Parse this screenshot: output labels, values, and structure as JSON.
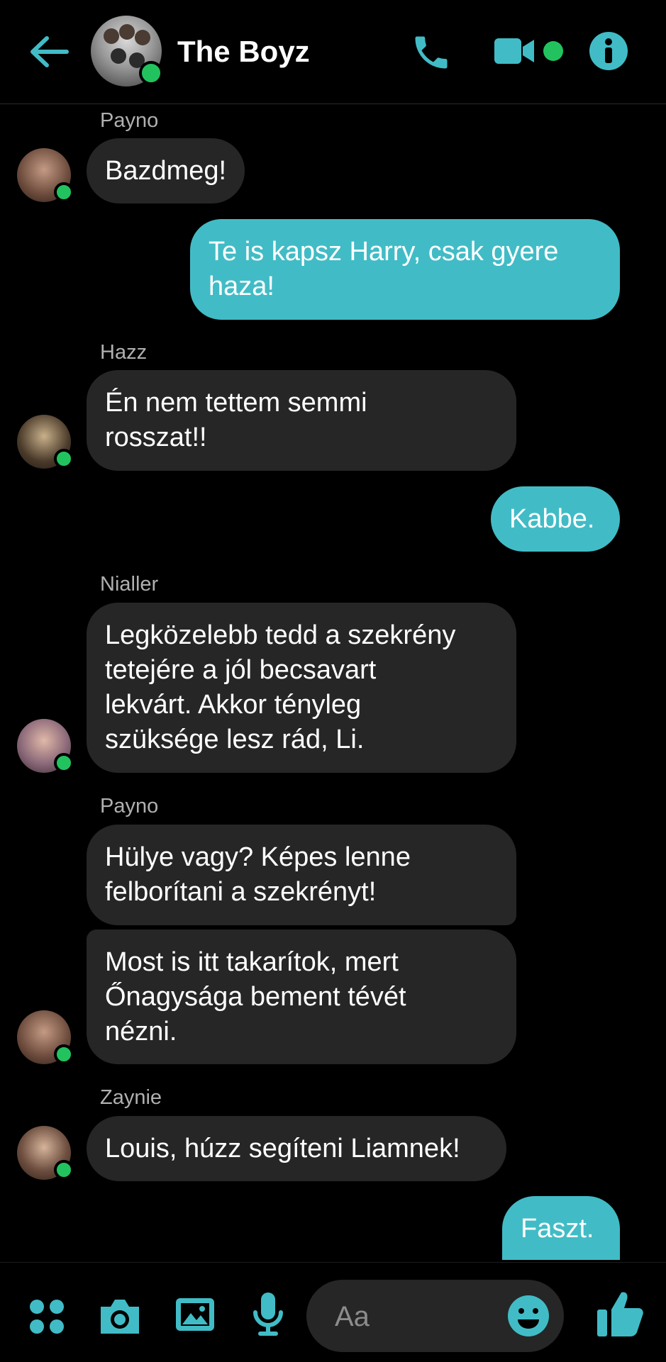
{
  "header": {
    "title": "The Boyz",
    "icons": [
      "back-arrow-icon",
      "phone-icon",
      "video-camera-icon",
      "info-icon"
    ]
  },
  "colors": {
    "accent": "#41bcc6",
    "online": "#22c35e",
    "incoming_bubble": "#262626"
  },
  "messages": [
    {
      "sender": "Payno",
      "text": "Bazdmeg!"
    },
    {
      "sender": "",
      "text_lines": [
        "Te is kapsz Harry, csak gyere",
        "haza!"
      ]
    },
    {
      "sender": "Hazz",
      "text_lines": [
        "Én nem tettem semmi",
        "rosszat!!"
      ]
    },
    {
      "sender": "",
      "text": "Kabbe."
    },
    {
      "sender": "Nialler",
      "text_lines": [
        "Legközelebb tedd a szekrény",
        "tetejére a jól becsavart",
        "lekvárt. Akkor tényleg",
        "szüksége lesz rád, Li."
      ]
    },
    {
      "sender": "Payno",
      "text_lines": [
        "Hülye vagy? Képes lenne",
        "felborítani a szekrényt!"
      ]
    },
    {
      "sender": "",
      "text_lines": [
        "Most is itt takarítok, mert",
        "Őnagysága bement tévét",
        "nézni."
      ]
    },
    {
      "sender": "Zaynie",
      "text": "Louis, húzz segíteni Liamnek!"
    },
    {
      "sender": "",
      "text": "Faszt."
    }
  ],
  "composer": {
    "placeholder": "Aa",
    "icons": [
      "apps-icon",
      "camera-icon",
      "image-icon",
      "microphone-icon",
      "emoji-icon",
      "thumbs-up-icon"
    ]
  }
}
